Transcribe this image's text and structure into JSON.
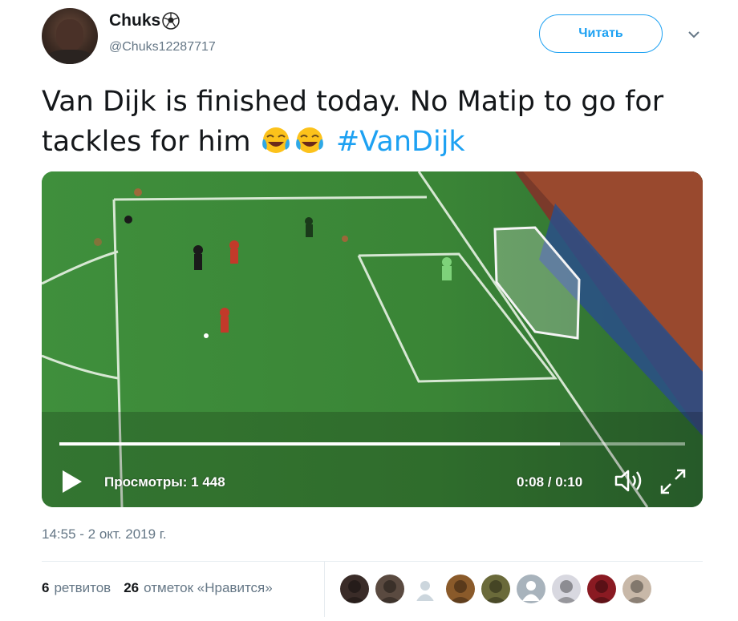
{
  "author": {
    "name": "Chuks",
    "handle": "@Chuks12287717",
    "emoji_icon": "soccer-ball-icon"
  },
  "follow_button": {
    "label": "Читать"
  },
  "tweet": {
    "text": "Van Dijk is finished today. No Matip to go for tackles for him",
    "emoji_icons": [
      "face-with-tears-of-joy-icon",
      "face-with-tears-of-joy-icon"
    ],
    "hashtag": "#VanDijk"
  },
  "video": {
    "views_label": "Просмотры: 1 448",
    "time_label": "0:08 / 0:10",
    "progress_fraction": 0.8,
    "pitch_color": "#3c8a3a"
  },
  "timestamp": "14:55 - 2 окт. 2019 г.",
  "stats": {
    "retweets_count": "6",
    "retweets_label": "ретвитов",
    "likes_count": "26",
    "likes_label": "отметок «Нравится»"
  },
  "likers": [
    {
      "icon": "avatar",
      "color": "#3a2c28"
    },
    {
      "icon": "avatar",
      "color": "#5a4a40"
    },
    {
      "icon": "default-avatar-icon",
      "color": "#ffffff"
    },
    {
      "icon": "avatar",
      "color": "#8a5a2a"
    },
    {
      "icon": "avatar",
      "color": "#6a6a3a"
    },
    {
      "icon": "default-avatar-icon",
      "color": "#a8b3bc"
    },
    {
      "icon": "avatar",
      "color": "#d8d8e0"
    },
    {
      "icon": "avatar",
      "color": "#8a1a22"
    },
    {
      "icon": "avatar",
      "color": "#c8b8a8"
    }
  ],
  "colors": {
    "accent": "#1da1f2",
    "secondary_text": "#657786",
    "primary_text": "#14171a"
  }
}
